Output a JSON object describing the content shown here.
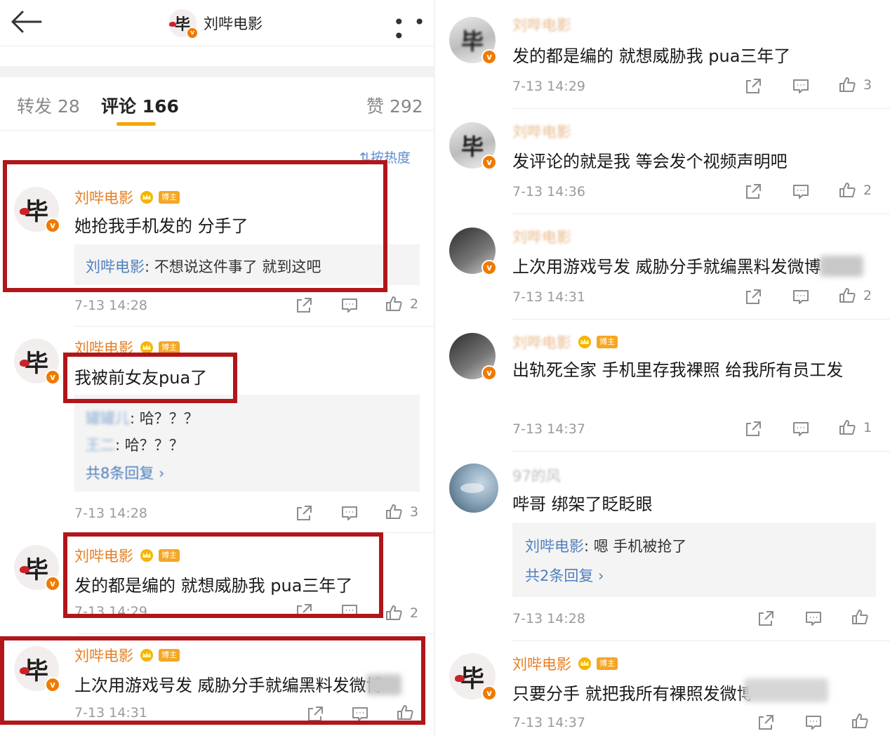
{
  "header": {
    "title": "刘哔电影"
  },
  "tabs": [
    {
      "label": "转发 28"
    },
    {
      "label": "评论 166"
    },
    {
      "label": "赞 292"
    }
  ],
  "sort_label": "按热度",
  "host_badge": "博主",
  "left_comments": [
    {
      "name": "刘哔电影",
      "text": "她抢我手机发的 分手了",
      "reply_name": "刘哔电影",
      "reply_text": ": 不想说这件事了 就到这吧",
      "time": "7-13 14:28",
      "likes": "2"
    },
    {
      "name": "刘哔电影",
      "text": "我被前女友pua了",
      "reply1_name": "罐罐儿",
      "reply1_text": ": 哈？？？",
      "reply2_name": "王二",
      "reply2_text": ": 哈？？？",
      "more_replies": "共8条回复 ›",
      "time": "7-13 14:28",
      "likes": "3"
    },
    {
      "name": "刘哔电影",
      "text": "发的都是编的 就想威胁我 pua三年了",
      "time": "7-13 14:29",
      "likes": "2"
    },
    {
      "name": "刘哔电影",
      "text": "上次用游戏号发 威胁分手就编黑料发微博",
      "time": "7-13 14:31"
    }
  ],
  "right_comments": [
    {
      "name": "刘哔电影",
      "text": "发的都是编的 就想威胁我 pua三年了",
      "time": "7-13 14:29",
      "likes": "3"
    },
    {
      "name": "刘哔电影",
      "text": "发评论的就是我 等会发个视频声明吧",
      "time": "7-13 14:36",
      "likes": "2"
    },
    {
      "name": "刘哔电影",
      "text": "上次用游戏号发 威胁分手就编黑料发微博",
      "time": "7-13 14:31",
      "likes": "2"
    },
    {
      "name": "刘哔电影",
      "text": "出轨死全家 手机里存我裸照 给我所有员工发",
      "time": "7-13 14:37",
      "likes": "1"
    },
    {
      "name": "97的风",
      "text": "哔哥  绑架了眨眨眼",
      "reply_name": "刘哔电影",
      "reply_text": ": 嗯 手机被抢了",
      "more_replies": "共2条回复 ›",
      "time": "7-13 14:28"
    },
    {
      "name": "刘哔电影",
      "text": "只要分手 就把我所有裸照发微博",
      "time": "7-13 14:37"
    }
  ]
}
